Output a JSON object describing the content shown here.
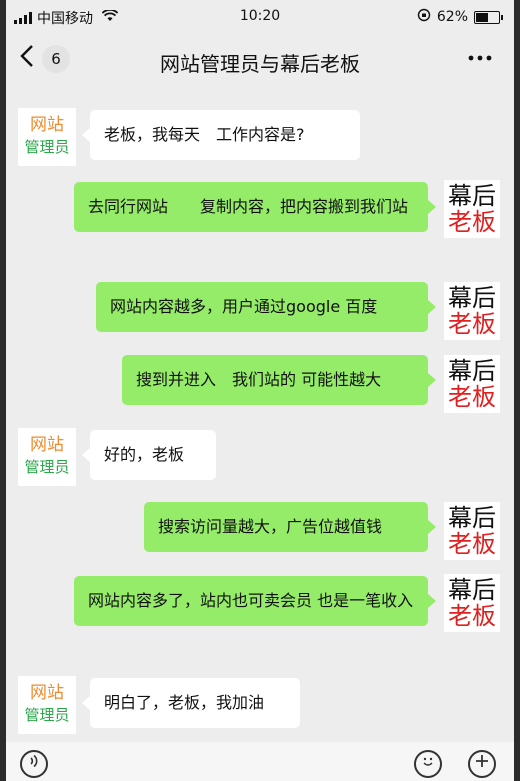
{
  "status": {
    "carrier": "中国移动",
    "time": "10:20",
    "battery": "62%",
    "battery_level": 0.62
  },
  "header": {
    "back_count": "6",
    "title": "网站管理员与幕后老板"
  },
  "avatars": {
    "left_line1": "网站",
    "left_line2": "管理员",
    "right_line1": "幕后",
    "right_line2": "老板"
  },
  "messages": [
    {
      "side": "in",
      "text": "老板，我每天　工作内容是?"
    },
    {
      "side": "out",
      "text": "去同行网站　　复制内容，把内容搬到我们站"
    },
    {
      "side": "out",
      "text": "网站内容越多，用户通过google 百度"
    },
    {
      "side": "out",
      "text": "搜到并进入　我们站的 可能性越大"
    },
    {
      "side": "in",
      "text": "好的，老板"
    },
    {
      "side": "out",
      "text": "搜索访问量越大，广告位越值钱"
    },
    {
      "side": "out",
      "text": "网站内容多了，站内也可卖会员 也是一笔收入"
    },
    {
      "side": "in",
      "text": "明白了，老板，我加油"
    }
  ],
  "icons": {
    "back": "chevron-left-icon",
    "more": "more-icon",
    "voice": "voice-icon",
    "emoji": "emoji-icon",
    "plus": "plus-icon"
  },
  "colors": {
    "outgoing_bubble": "#95ec69",
    "incoming_bubble": "#ffffff",
    "avatar_orange": "#f08c2e",
    "avatar_green": "#2aa84a",
    "avatar_red": "#e02020"
  }
}
